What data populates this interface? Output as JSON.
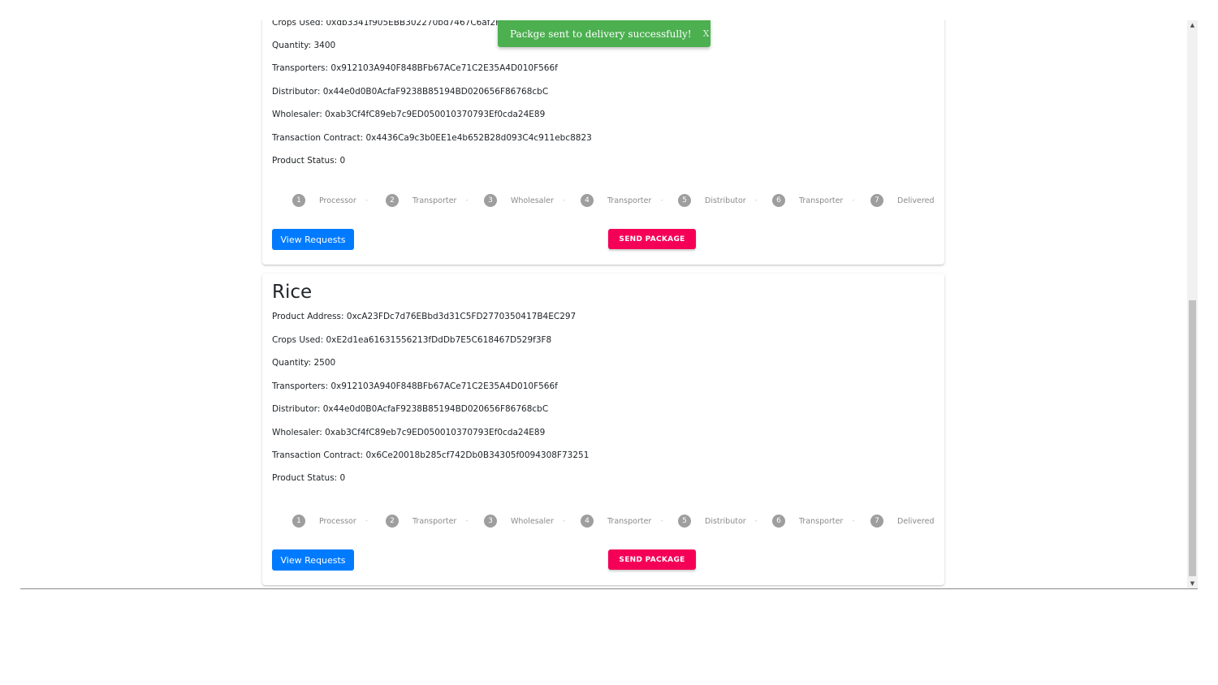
{
  "toast": {
    "message": "Packge sent to delivery successfully!",
    "close": "X"
  },
  "steps": [
    "Processor",
    "Transporter",
    "Wholesaler",
    "Transporter",
    "Distributor",
    "Transporter",
    "Delivered"
  ],
  "step_numbers": [
    "1",
    "2",
    "3",
    "4",
    "5",
    "6",
    "7"
  ],
  "step_separator": "-",
  "products": [
    {
      "crops_partial": "Crops Used: 0xdb3341f905EBB302270bd7467C6af2F0D1",
      "quantity": "Quantity: 3400",
      "transporters": "Transporters: 0x912103A940F848BFb67ACe71C2E35A4D010F566f",
      "distributor": "Distributor: 0x44e0d0B0AcfaF9238B85194BD020656F86768cbC",
      "wholesaler": "Wholesaler: 0xab3Cf4fC89eb7c9ED050010370793Ef0cda24E89",
      "contract": "Transaction Contract: 0x4436Ca9c3b0EE1e4b652B28d093C4c911ebc8823",
      "status": "Product Status: 0",
      "view_label": "View Requests",
      "send_label": "SEND PACKAGE"
    },
    {
      "title": "Rice",
      "address": "Product Address: 0xcA23FDc7d76EBbd3d31C5FD2770350417B4EC297",
      "crops": "Crops Used: 0xE2d1ea61631556213fDdDb7E5C618467D529f3F8",
      "quantity": "Quantity: 2500",
      "transporters": "Transporters: 0x912103A940F848BFb67ACe71C2E35A4D010F566f",
      "distributor": "Distributor: 0x44e0d0B0AcfaF9238B85194BD020656F86768cbC",
      "wholesaler": "Wholesaler: 0xab3Cf4fC89eb7c9ED050010370793Ef0cda24E89",
      "contract": "Transaction Contract: 0x6Ce20018b285cf742Db0B34305f0094308F73251",
      "status": "Product Status: 0",
      "view_label": "View Requests",
      "send_label": "SEND PACKAGE"
    }
  ],
  "colors": {
    "primary": "#007bff",
    "accent": "#f50057",
    "success": "#4caf50",
    "step_inactive": "#9e9e9e"
  },
  "icons": {
    "scroll_up": "triangle-up-icon",
    "scroll_down": "triangle-down-icon"
  }
}
